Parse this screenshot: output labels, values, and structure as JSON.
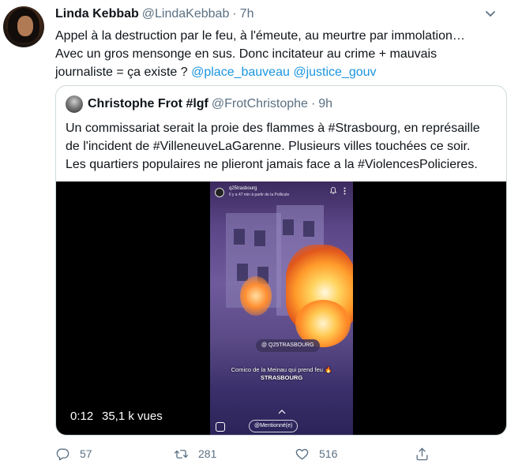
{
  "tweet": {
    "author_name": "Linda Kebbab",
    "author_handle": "@LindaKebbab",
    "separator": "·",
    "time": "7h",
    "text_line1": "Appel à la destruction par le feu, à l'émeute, au meurtre par immolation…",
    "text_line2": "Avec un gros mensonge en sus. Donc incitateur au crime + mauvais",
    "text_line3_plain": "journaliste = ça existe ? ",
    "mention1": "@place_bauveau",
    "mention2": "@justice_gouv"
  },
  "quoted": {
    "author_name": "Christophe Frot #lgf",
    "author_handle": "@FrotChristophe",
    "separator": "·",
    "time": "9h",
    "text_line1": "Un commissariat serait la proie des flammes à #Strasbourg, en représaille",
    "text_line2": "de l'incident de #VilleneuveLaGarenne. Plusieurs villes touchées ce soir.",
    "text_line3": "Les quartiers populaires ne plieront jamais face a la #ViolencesPolicieres.",
    "video": {
      "time": "0:12",
      "views": "35,1 k vues",
      "embedded_user": "q25trasbourg",
      "embedded_subtitle": "Il y a 47 min à partir de la Pollicule",
      "tag": "@ Q25TRASBOURG",
      "caption_line1": "Comico de la Meinau qui prend feu 🔥",
      "caption_line2": "STRASBOURG",
      "mention": "@Mentionné(e)"
    }
  },
  "actions": {
    "reply_count": "57",
    "retweet_count": "281",
    "like_count": "516"
  },
  "colors": {
    "link": "#1b95e0",
    "secondary": "#5b7083",
    "border": "#cfd9de"
  },
  "icons": [
    "caret-down-icon",
    "reply-icon",
    "retweet-icon",
    "like-icon",
    "share-icon",
    "bell-icon",
    "more-icon"
  ]
}
